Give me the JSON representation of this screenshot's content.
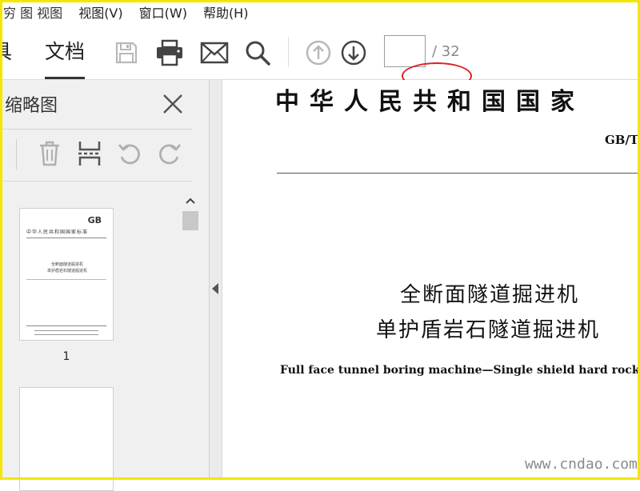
{
  "menubar": {
    "items": [
      {
        "label": "穷 图 视图 ",
        "partial": true
      },
      {
        "label": "视图(V)"
      },
      {
        "label": "窗口(W)"
      },
      {
        "label": "帮助(H)"
      }
    ]
  },
  "toolbar": {
    "tab_tools": "具",
    "tab_document": "文档",
    "page_current": "",
    "page_total": "/ 32",
    "icons": [
      "save-icon",
      "print-icon",
      "mail-icon",
      "search-icon",
      "page-up-icon",
      "page-down-icon"
    ]
  },
  "sidepanel": {
    "title": "缩略图",
    "tools": [
      "delete-icon",
      "extract-icon",
      "rotate-left-icon",
      "rotate-right-icon"
    ],
    "thumbnails": [
      {
        "label": "1",
        "gb": "GB",
        "header": "中华人民共和国国家标准",
        "title1": "全断面隧道掘进机",
        "title2": "单护盾岩石隧道掘进机"
      },
      {
        "label": ""
      }
    ]
  },
  "document": {
    "header": "中华人民共和国国家",
    "code": "GB/T",
    "title_line1": "全断面隧道掘进机",
    "title_line2": "单护盾岩石隧道掘进机",
    "title_english": "Full face tunnel boring machine—Single shield hard rock tunnel"
  },
  "watermark": "www.cndao.com",
  "colors": {
    "frame": "#f4e600",
    "annotation": "#e02020",
    "panel": "#f0f0f0",
    "icon": "#444444",
    "icon_disabled": "#b8b8b8"
  }
}
